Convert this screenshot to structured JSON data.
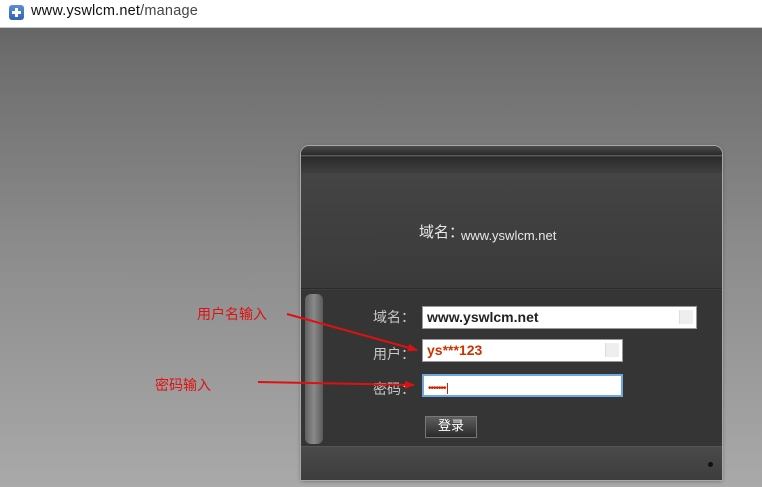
{
  "browser": {
    "url_host": "www.yswlcm.net",
    "url_path": "/manage"
  },
  "header": {
    "domain_label": "域名：",
    "domain_value": "www.yswlcm.net"
  },
  "form": {
    "domain_label": "域名：",
    "domain_value": "www.yswlcm.net",
    "user_label": "用户：",
    "user_value": "ys***123",
    "password_label": "密码：",
    "password_value": "•••••••",
    "login_button": "登录"
  },
  "annotations": {
    "username_note": "用户名输入",
    "password_note": "密码输入"
  },
  "colors": {
    "annotation": "#e01010",
    "user_value": "#cc3300"
  }
}
